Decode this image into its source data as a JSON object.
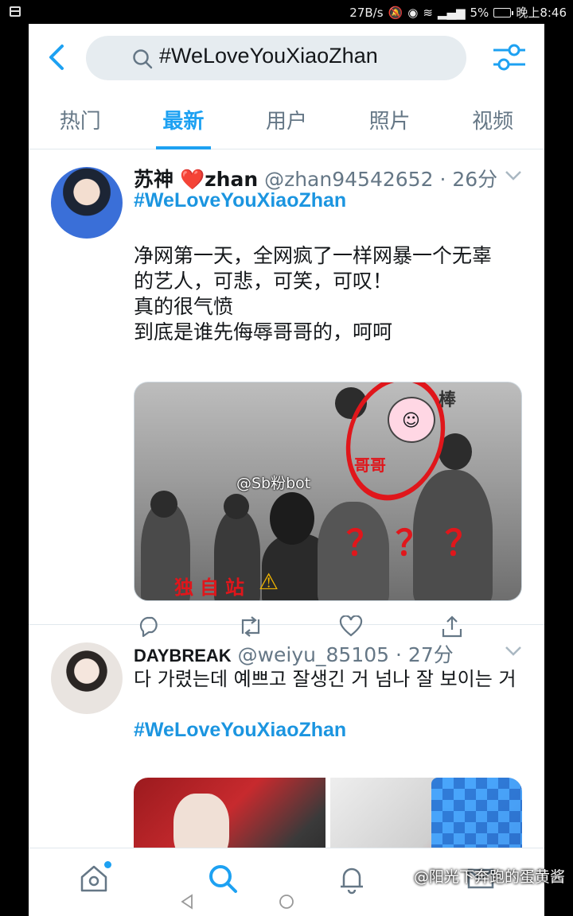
{
  "status_bar": {
    "net_speed": "27B/s",
    "battery_percent": "5%",
    "time": "晚上8:46"
  },
  "header": {
    "search_query": "#WeLoveYouXiaoZhan"
  },
  "tabs": [
    {
      "label": "热门",
      "active": false
    },
    {
      "label": "最新",
      "active": true
    },
    {
      "label": "用户",
      "active": false
    },
    {
      "label": "照片",
      "active": false
    },
    {
      "label": "视频",
      "active": false
    }
  ],
  "tweets": [
    {
      "name_prefix": "苏神",
      "name_suffix": "zhan",
      "handle": "@zhan94542652",
      "time": "26分",
      "hashtag": "#WeLoveYouXiaoZhan",
      "text": "净网第一天，全网疯了一样网暴一个无辜\n的艺人，可悲，可笑，可叹！\n真的很气愤\n到底是谁先侮辱哥哥的，呵呵",
      "image_overlay": {
        "watermark": "@Sb粉bot",
        "circle_label": "哥哥",
        "sticker_label": "棒",
        "question_marks": "？？？",
        "bottom_text": "独自站"
      }
    },
    {
      "name": "DAYBREAK",
      "handle": "@weiyu_85105",
      "time": "27分",
      "text": "다 가렸는데 예쁘고 잘생긴 거 넘나 잘 보이는 거",
      "hashtag": "#WeLoveYouXiaoZhan"
    }
  ],
  "footer_watermark": "@阳光下奔跑的蛋黄酱",
  "colors": {
    "accent": "#1da1f2",
    "heart": "#e0245e",
    "annotation_red": "#e0161b"
  }
}
